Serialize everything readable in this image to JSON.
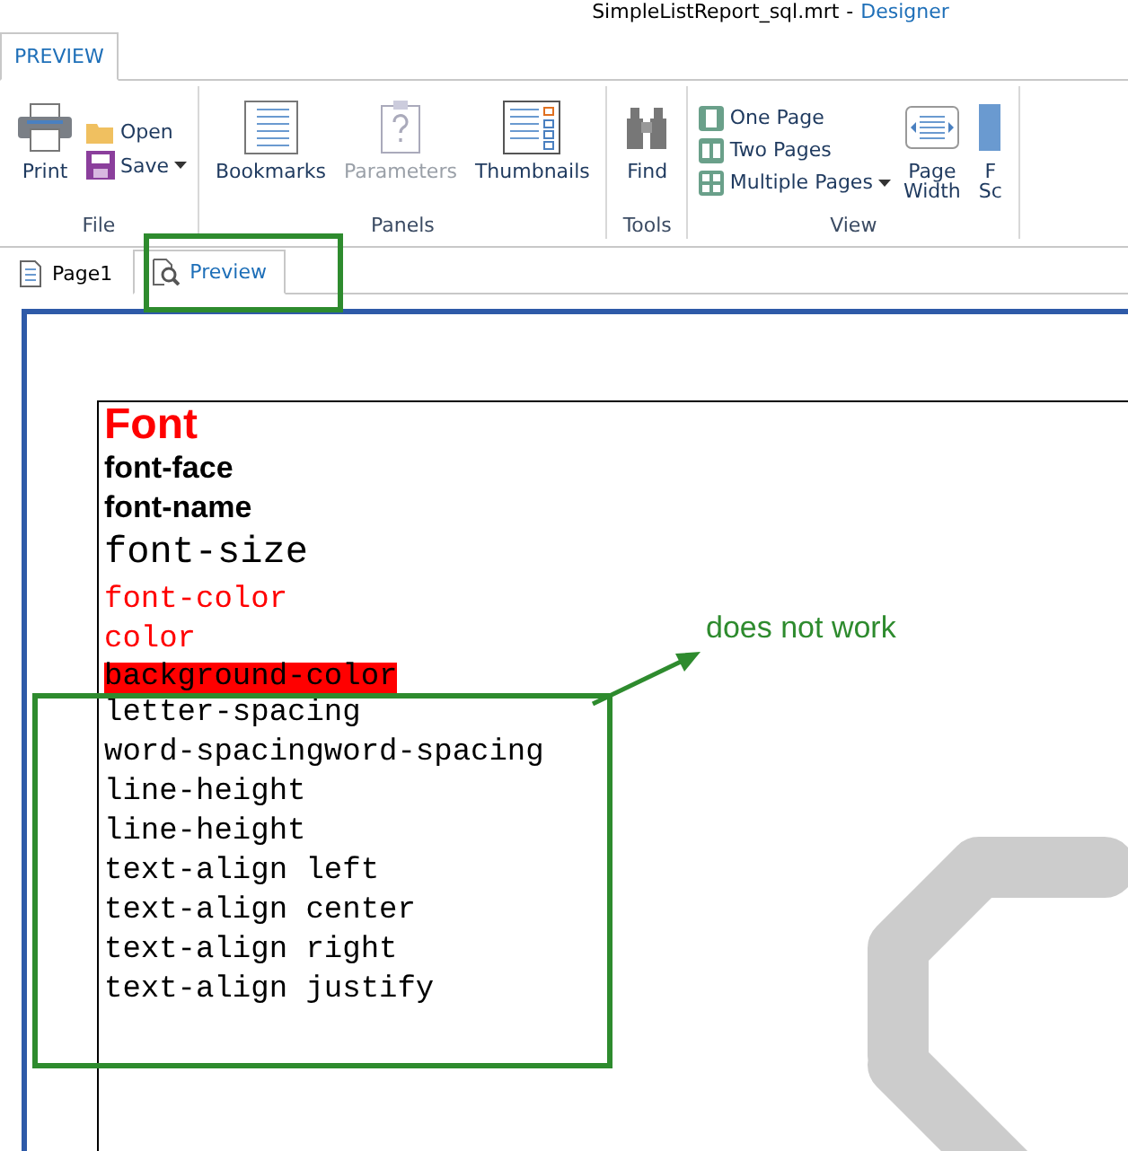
{
  "window": {
    "title": "SimpleListReport_sql.mrt",
    "separator": "-",
    "app": "Designer"
  },
  "ribbon_tabs": [
    {
      "label": "PREVIEW",
      "selected": true
    }
  ],
  "groups": [
    {
      "label": "File",
      "buttons": [
        {
          "kind": "large",
          "label": "Print",
          "disabled": false
        },
        {
          "kind": "small",
          "label": "Open",
          "disabled": false,
          "dropdown": false
        },
        {
          "kind": "small",
          "label": "Save",
          "disabled": false,
          "dropdown": true
        }
      ]
    },
    {
      "label": "Panels",
      "buttons": [
        {
          "kind": "large",
          "label": "Bookmarks",
          "disabled": false
        },
        {
          "kind": "large",
          "label": "Parameters",
          "disabled": true
        },
        {
          "kind": "large",
          "label": "Thumbnails",
          "disabled": false
        }
      ]
    },
    {
      "label": "Tools",
      "buttons": [
        {
          "kind": "large",
          "label": "Find",
          "disabled": false
        }
      ]
    },
    {
      "label": "View",
      "buttons": [
        {
          "kind": "small",
          "label": "One Page",
          "disabled": false,
          "dropdown": false
        },
        {
          "kind": "small",
          "label": "Two Pages",
          "disabled": false,
          "dropdown": false
        },
        {
          "kind": "small",
          "label": "Multiple Pages",
          "disabled": false,
          "dropdown": true
        },
        {
          "kind": "large",
          "label": "Page\nWidth",
          "disabled": false
        },
        {
          "kind": "large",
          "label": "F\nSc",
          "disabled": false
        }
      ]
    }
  ],
  "doc_tabs": [
    {
      "label": "Page1",
      "selected": false
    },
    {
      "label": "Preview",
      "selected": true
    }
  ],
  "report_lines": [
    {
      "kind": "title",
      "text": "Font"
    },
    {
      "kind": "bold",
      "text": "font-face"
    },
    {
      "kind": "bold",
      "text": "font-name"
    },
    {
      "kind": "large",
      "text": "font-size"
    },
    {
      "kind": "red",
      "text": "font-color"
    },
    {
      "kind": "red",
      "text": "color"
    },
    {
      "kind": "highlight",
      "text": "background-color"
    },
    {
      "kind": "plain",
      "text": "letter-spacing"
    },
    {
      "kind": "plain",
      "text": "word-spacingword-spacing"
    },
    {
      "kind": "plain",
      "text": "line-height"
    },
    {
      "kind": "plain",
      "text": "line-height"
    },
    {
      "kind": "plain",
      "text": "text-align left"
    },
    {
      "kind": "plain",
      "text": "text-align center"
    },
    {
      "kind": "plain",
      "text": "text-align right"
    },
    {
      "kind": "plain",
      "text": "text-align justify"
    }
  ],
  "annotation": {
    "text": "does not work"
  }
}
